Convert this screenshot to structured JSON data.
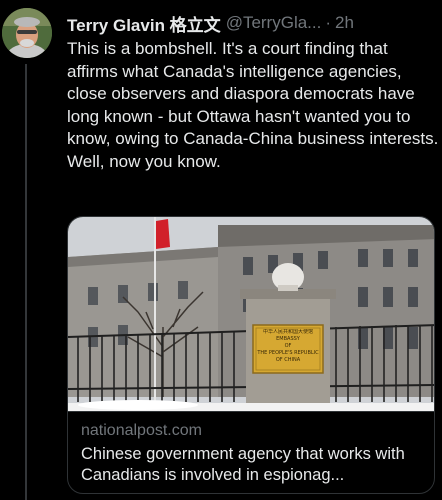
{
  "tweet": {
    "display_name": "Terry Glavin 格立文",
    "handle": "@TerryGla...",
    "separator": "·",
    "time": "2h",
    "text": "This is a bombshell. It's a court finding that affirms what Canada's intelligence agencies, close observers and diaspora democrats have long known - but Ottawa hasn't wanted you to know, owing to Canada-China business interests.\nWell, now you know."
  },
  "card": {
    "domain": "nationalpost.com",
    "title": "Chinese government agency that works with Canadians is involved in espionag...",
    "plaque_text": "中华人民共和国大使馆\nEMBASSY\nOF\nTHE PEOPLE'S REPUBLIC OF CHINA"
  }
}
